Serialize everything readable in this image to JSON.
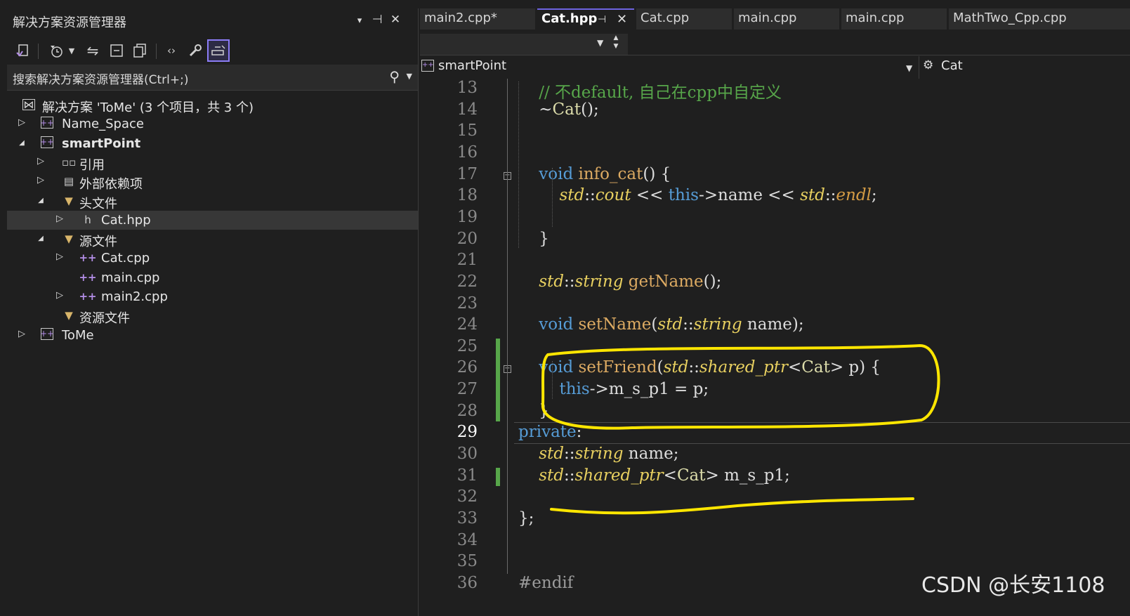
{
  "solution_explorer": {
    "title": "解决方案资源管理器",
    "title_buttons": [
      "▾",
      "⊣",
      "✕"
    ],
    "search_placeholder": "搜索解决方案资源管理器(Ctrl+;)",
    "tree": [
      {
        "label": "解决方案 'ToMe' (3 个项目，共 3 个)",
        "icon": "solution-icon",
        "level": 0,
        "arrow": ""
      },
      {
        "label": "Name_Space",
        "icon": "project-icon",
        "level": 0,
        "arrow": "collapsed"
      },
      {
        "label": "smartPoint",
        "icon": "project-icon",
        "level": 0,
        "arrow": "expanded",
        "bold": true
      },
      {
        "label": "引用",
        "icon": "references-icon",
        "level": 1,
        "arrow": "collapsed"
      },
      {
        "label": "外部依赖项",
        "icon": "external-deps-icon",
        "level": 1,
        "arrow": "collapsed"
      },
      {
        "label": "头文件",
        "icon": "folder-filter-icon",
        "level": 1,
        "arrow": "expanded"
      },
      {
        "label": "Cat.hpp",
        "icon": "header-file-icon",
        "level": 2,
        "arrow": "collapsed",
        "selected": true
      },
      {
        "label": "源文件",
        "icon": "folder-filter-icon",
        "level": 1,
        "arrow": "expanded"
      },
      {
        "label": "Cat.cpp",
        "icon": "cpp-file-icon",
        "level": 2,
        "arrow": "collapsed"
      },
      {
        "label": "main.cpp",
        "icon": "cpp-file-icon",
        "level": 2,
        "arrow": ""
      },
      {
        "label": "main2.cpp",
        "icon": "cpp-file-icon",
        "level": 2,
        "arrow": "collapsed"
      },
      {
        "label": "资源文件",
        "icon": "folder-filter-icon",
        "level": 1,
        "arrow": ""
      },
      {
        "label": "ToMe",
        "icon": "project-icon",
        "level": 0,
        "arrow": "collapsed"
      }
    ]
  },
  "editor": {
    "tabs": [
      {
        "label": "main2.cpp*",
        "active": false
      },
      {
        "label": "Cat.hpp",
        "active": true
      },
      {
        "label": "Cat.cpp",
        "active": false
      },
      {
        "label": "main.cpp",
        "active": false
      },
      {
        "label": "main.cpp",
        "active": false
      },
      {
        "label": "MathTwo_Cpp.cpp",
        "active": false
      }
    ],
    "nav_project": "smartPoint",
    "nav_scope": "Cat",
    "current_line": 29,
    "lines": [
      {
        "n": 13,
        "tokens": [
          [
            "cm",
            "    // 不default, 自己在cpp中自定义"
          ]
        ]
      },
      {
        "n": 14,
        "tokens": [
          [
            "id",
            "    ~"
          ],
          [
            "ev",
            "Cat"
          ],
          [
            "id",
            "();"
          ]
        ]
      },
      {
        "n": 15,
        "tokens": []
      },
      {
        "n": 16,
        "tokens": []
      },
      {
        "n": 17,
        "tokens": [
          [
            "kw",
            "    void "
          ],
          [
            "fn",
            "info_cat"
          ],
          [
            "id",
            "() {"
          ]
        ]
      },
      {
        "n": 18,
        "tokens": [
          [
            "id",
            "        "
          ],
          [
            "ty",
            "std"
          ],
          [
            "id",
            "::"
          ],
          [
            "ty",
            "cout"
          ],
          [
            "id",
            " << "
          ],
          [
            "kw",
            "this"
          ],
          [
            "id",
            "->name << "
          ],
          [
            "ty",
            "std"
          ],
          [
            "id",
            "::"
          ],
          [
            "ed",
            "endl"
          ],
          [
            "id",
            ";"
          ]
        ]
      },
      {
        "n": 19,
        "tokens": []
      },
      {
        "n": 20,
        "tokens": [
          [
            "id",
            "    }"
          ]
        ]
      },
      {
        "n": 21,
        "tokens": []
      },
      {
        "n": 22,
        "tokens": [
          [
            "id",
            "    "
          ],
          [
            "ty",
            "std"
          ],
          [
            "id",
            "::"
          ],
          [
            "ty",
            "string"
          ],
          [
            "id",
            " "
          ],
          [
            "fn",
            "getName"
          ],
          [
            "id",
            "();"
          ]
        ]
      },
      {
        "n": 23,
        "tokens": []
      },
      {
        "n": 24,
        "tokens": [
          [
            "kw",
            "    void "
          ],
          [
            "fn",
            "setName"
          ],
          [
            "id",
            "("
          ],
          [
            "ty",
            "std"
          ],
          [
            "id",
            "::"
          ],
          [
            "ty",
            "string"
          ],
          [
            "id",
            " name);"
          ]
        ]
      },
      {
        "n": 25,
        "tokens": []
      },
      {
        "n": 26,
        "tokens": [
          [
            "kw",
            "    void "
          ],
          [
            "fn",
            "setFriend"
          ],
          [
            "id",
            "("
          ],
          [
            "ty",
            "std"
          ],
          [
            "id",
            "::"
          ],
          [
            "ty",
            "shared_ptr"
          ],
          [
            "id",
            "<"
          ],
          [
            "ev",
            "Cat"
          ],
          [
            "id",
            "> p) {"
          ]
        ]
      },
      {
        "n": 27,
        "tokens": [
          [
            "id",
            "        "
          ],
          [
            "kw",
            "this"
          ],
          [
            "id",
            "->m_s_p1 = p;"
          ]
        ]
      },
      {
        "n": 28,
        "tokens": [
          [
            "id",
            "    }"
          ]
        ]
      },
      {
        "n": 29,
        "tokens": [
          [
            "kw",
            "private"
          ],
          [
            "id",
            ":"
          ]
        ]
      },
      {
        "n": 30,
        "tokens": [
          [
            "id",
            "    "
          ],
          [
            "ty",
            "std"
          ],
          [
            "id",
            "::"
          ],
          [
            "ty",
            "string"
          ],
          [
            "id",
            " name;"
          ]
        ]
      },
      {
        "n": 31,
        "tokens": [
          [
            "id",
            "    "
          ],
          [
            "ty",
            "std"
          ],
          [
            "id",
            "::"
          ],
          [
            "ty",
            "shared_ptr"
          ],
          [
            "id",
            "<"
          ],
          [
            "ev",
            "Cat"
          ],
          [
            "id",
            "> m_s_p1;"
          ]
        ]
      },
      {
        "n": 32,
        "tokens": []
      },
      {
        "n": 33,
        "tokens": [
          [
            "id",
            "};"
          ]
        ]
      },
      {
        "n": 34,
        "tokens": []
      },
      {
        "n": 35,
        "tokens": []
      },
      {
        "n": 36,
        "tokens": [
          [
            "pp",
            "#endif"
          ]
        ]
      }
    ]
  },
  "watermark": "CSDN @长安1108",
  "colors": {
    "accent": "#6d63e0",
    "annotation": "#ffe600",
    "change_marker": "#57a64a",
    "keyword": "#569cd6",
    "comment": "#57a64a"
  }
}
